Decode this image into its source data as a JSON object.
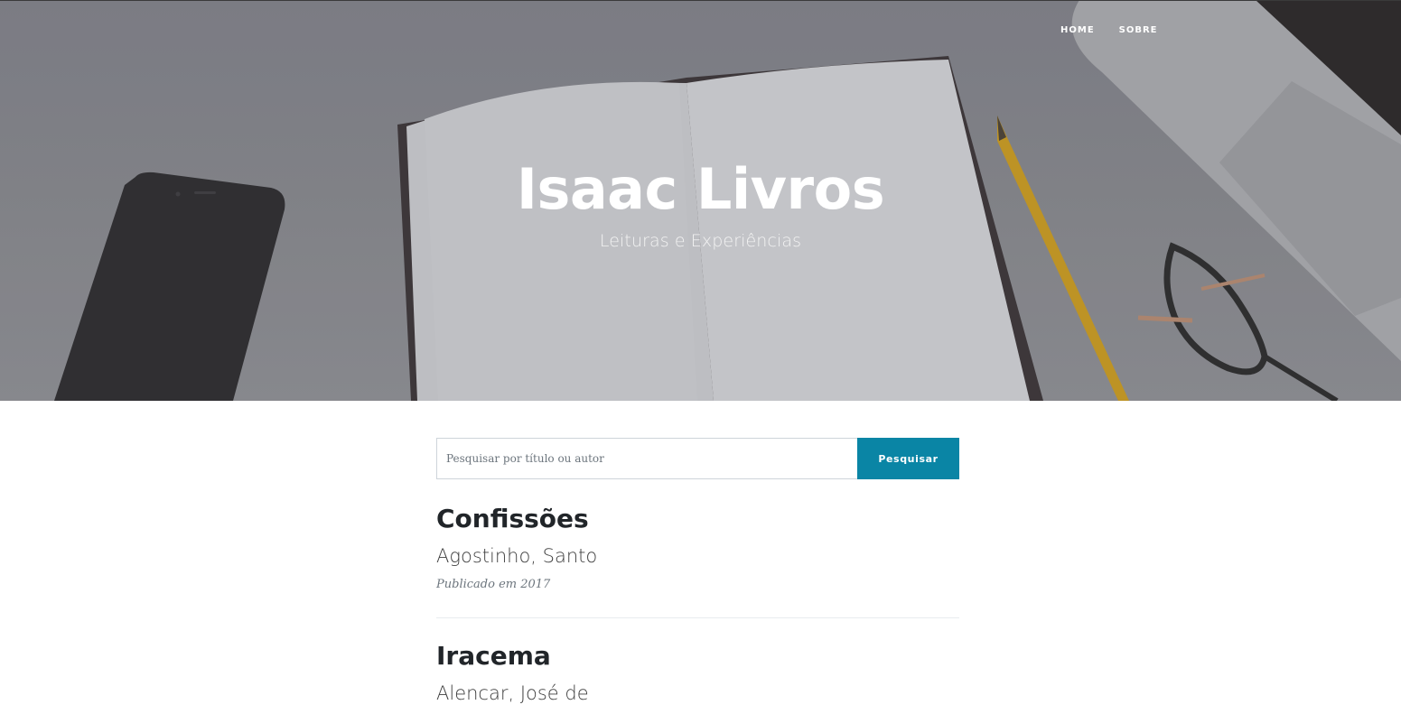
{
  "nav": {
    "items": [
      "HOME",
      "SOBRE"
    ]
  },
  "header": {
    "title": "Isaac Livros",
    "subtitle": "Leituras e Experiências"
  },
  "search": {
    "placeholder": "Pesquisar por título ou autor",
    "value": "",
    "button_label": "Pesquisar"
  },
  "posts": [
    {
      "title": "Confissões",
      "author": "Agostinho, Santo",
      "meta": "Publicado em 2017"
    },
    {
      "title": "Iracema",
      "author": "Alencar, José de"
    }
  ],
  "colors": {
    "accent": "#0a85a5",
    "hero_overlay": "#808188",
    "title_text": "#212529"
  },
  "icons": [
    "phone-image",
    "notebook-image",
    "pencil-image",
    "glasses-image",
    "laptop-image"
  ]
}
